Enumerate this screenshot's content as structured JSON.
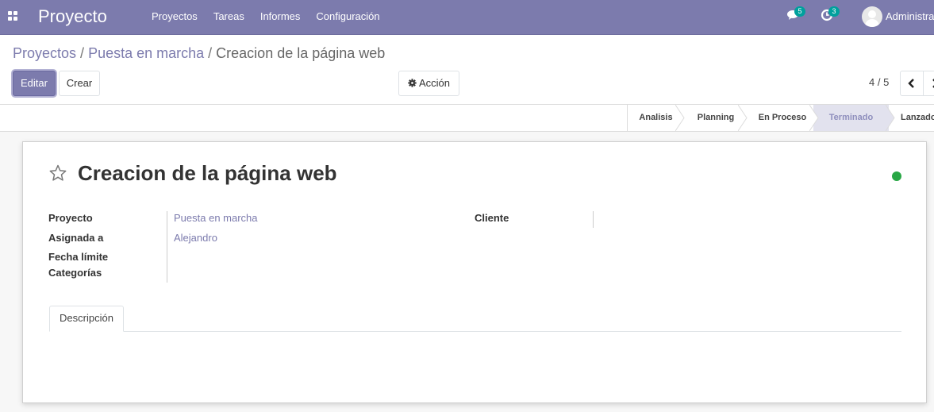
{
  "navbar": {
    "brand": "Proyecto",
    "menu": [
      "Proyectos",
      "Tareas",
      "Informes",
      "Configuración"
    ],
    "messages_count": "5",
    "activities_count": "3",
    "user_name": "Administrator",
    "bg_color": "#7c7bad"
  },
  "breadcrumb": {
    "items": [
      "Proyectos",
      "Puesta en marcha"
    ],
    "current": "Creacion de la página web",
    "separator": "/"
  },
  "actions": {
    "edit_label": "Editar",
    "create_label": "Crear",
    "action_label": "Acción"
  },
  "pager": {
    "value": "4 / 5"
  },
  "stages": [
    {
      "label": "Analisis",
      "active": false
    },
    {
      "label": "Planning",
      "active": false
    },
    {
      "label": "En Proceso",
      "active": false
    },
    {
      "label": "Terminado",
      "active": true
    },
    {
      "label": "Lanzado",
      "active": false
    }
  ],
  "record": {
    "title": "Creacion de la página web",
    "status_color": "#28a745",
    "fields_left": [
      {
        "label": "Proyecto",
        "value": "Puesta en marcha"
      },
      {
        "label": "Asignada a",
        "value": "Alejandro"
      },
      {
        "label": "Fecha límite",
        "value": ""
      },
      {
        "label": "Categorías",
        "value": ""
      }
    ],
    "fields_right": [
      {
        "label": "Cliente",
        "value": ""
      }
    ]
  },
  "tabs": [
    "Descripción"
  ]
}
